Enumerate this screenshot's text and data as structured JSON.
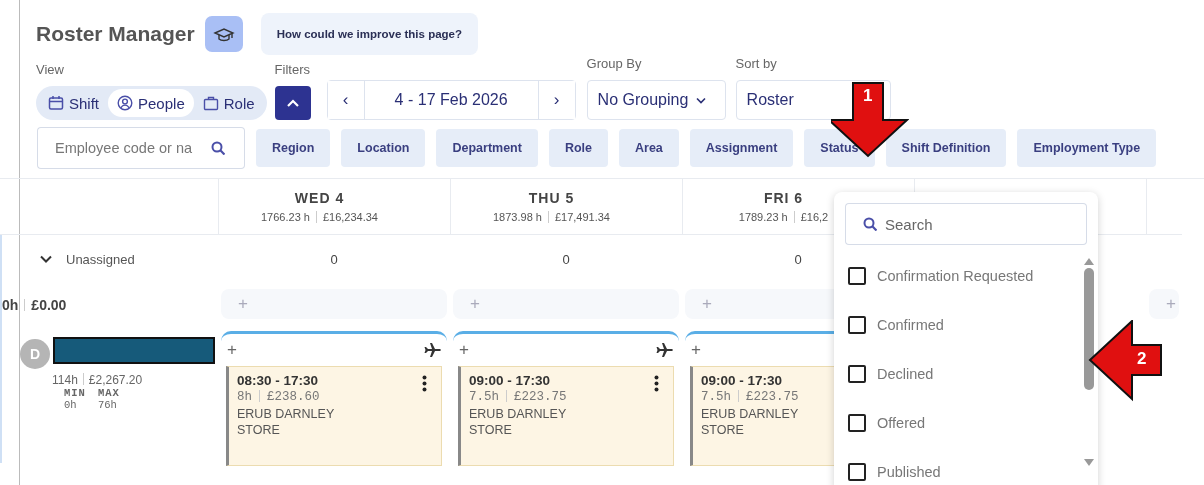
{
  "header": {
    "title": "Roster Manager",
    "feedback_button": "How could we improve this page?"
  },
  "view": {
    "label": "View",
    "options": [
      {
        "label": "Shift",
        "selected": false
      },
      {
        "label": "People",
        "selected": true
      },
      {
        "label": "Role",
        "selected": false
      }
    ]
  },
  "filters": {
    "label": "Filters",
    "expanded": true
  },
  "date_range": {
    "value": "4 - 17 Feb 2026",
    "prev": "‹",
    "next": "›"
  },
  "group_by": {
    "label": "Group By",
    "value": "No Grouping"
  },
  "sort_by": {
    "label": "Sort by",
    "value": "Roster"
  },
  "search": {
    "placeholder": "Employee code or na"
  },
  "filter_chips": [
    "Region",
    "Location",
    "Department",
    "Role",
    "Area",
    "Assignment",
    "Status",
    "Shift Definition",
    "Employment Type"
  ],
  "days": [
    {
      "name": "WED 4",
      "hours": "1766.23 h",
      "cost": "£16,234.34"
    },
    {
      "name": "THU 5",
      "hours": "1873.98 h",
      "cost": "£17,491.34"
    },
    {
      "name": "FRI 6",
      "hours": "1789.23 h",
      "cost": "£16,2"
    }
  ],
  "unassigned": {
    "label": "Unassigned",
    "expanded": true,
    "counts": [
      "0",
      "0",
      "0"
    ],
    "hours": "0h",
    "cost": "£0.00",
    "add_buttons": [
      "+",
      "+",
      "+",
      "+"
    ]
  },
  "employee": {
    "initial": "D",
    "hours": "114h",
    "cost": "£2,267.20",
    "min_label": "MIN",
    "max_label": "MAX",
    "min": "0h",
    "max": "76h",
    "shifts": [
      {
        "add": "+",
        "leave": true,
        "menu": true,
        "time": "08:30 - 17:30",
        "hours": "8h",
        "cost": "£238.60",
        "location": "ERUB DARNLEY STORE"
      },
      {
        "add": "+",
        "leave": true,
        "menu": true,
        "time": "09:00 - 17:30",
        "hours": "7.5h",
        "cost": "£223.75",
        "location": "ERUB DARNLEY STORE"
      },
      {
        "add": "+",
        "time": "09:00 - 17:30",
        "hours": "7.5h",
        "cost": "£223.75",
        "location": "ERUB DARNLEY STORE"
      }
    ]
  },
  "status_dropdown": {
    "search_placeholder": "Search",
    "options": [
      {
        "label": "Confirmation Requested",
        "checked": false
      },
      {
        "label": "Confirmed",
        "checked": false
      },
      {
        "label": "Declined",
        "checked": false
      },
      {
        "label": "Offered",
        "checked": false
      },
      {
        "label": "Published",
        "checked": false
      }
    ]
  },
  "annotations": [
    {
      "label": "1"
    },
    {
      "label": "2"
    }
  ]
}
